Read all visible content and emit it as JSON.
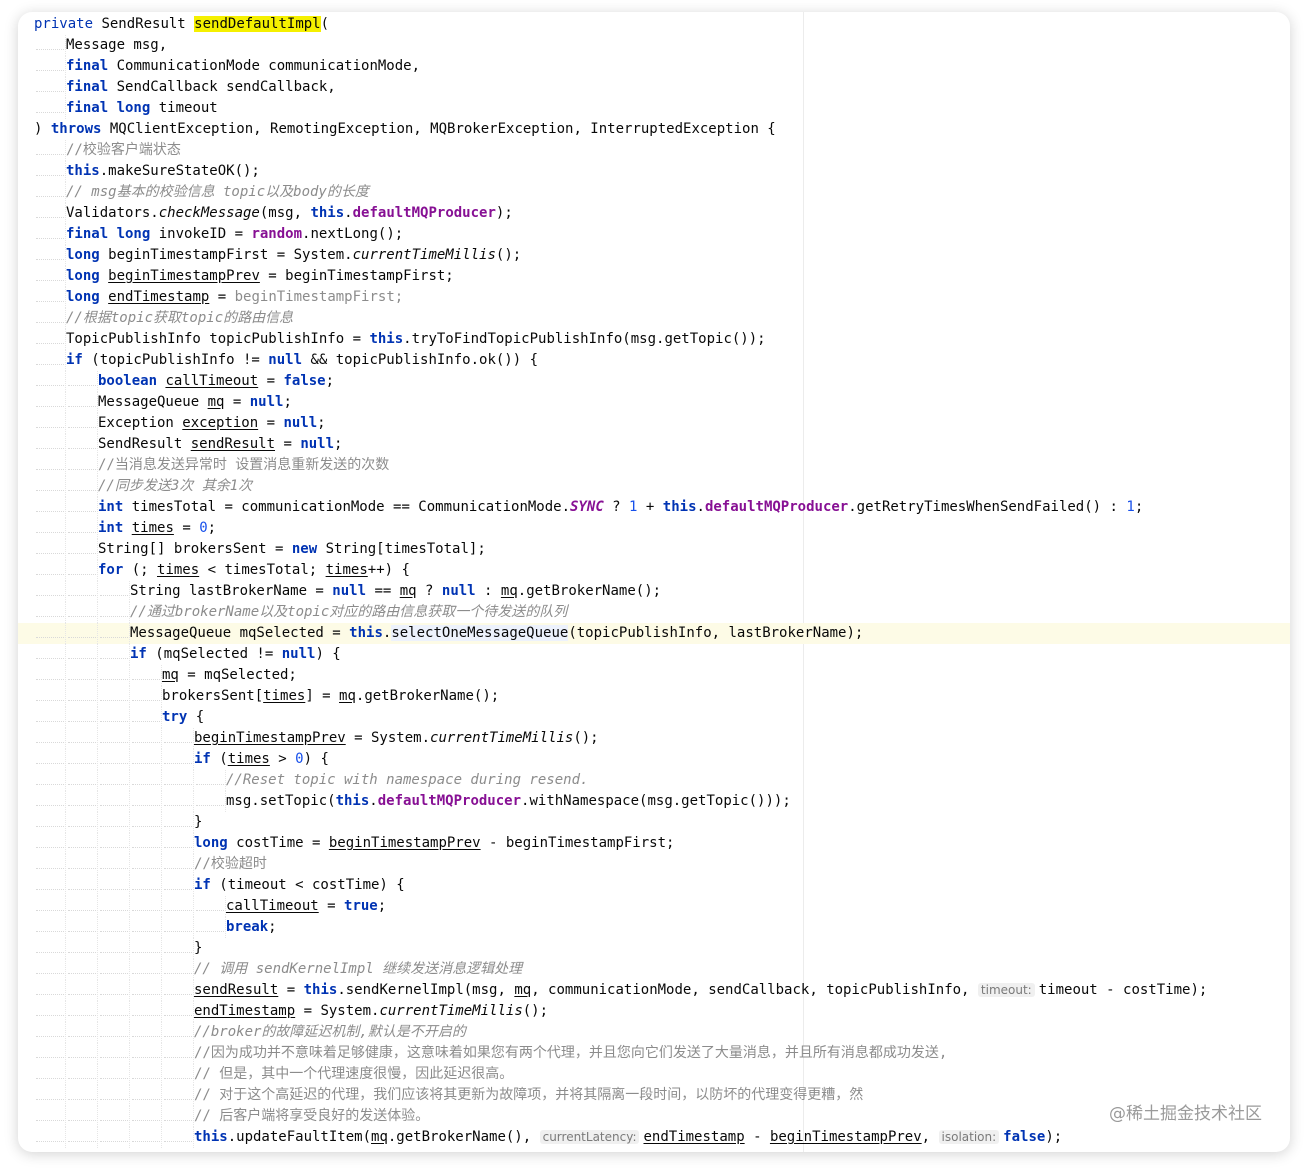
{
  "lines": [
    {
      "indent": 0,
      "hl": false,
      "tokens": [
        {
          "t": "private",
          "c": "kwn"
        },
        {
          "t": " SendResult "
        },
        {
          "t": "sendDefaultImpl",
          "c": "mhl"
        },
        {
          "t": "("
        }
      ]
    },
    {
      "indent": 1,
      "hl": false,
      "tokens": [
        {
          "t": "Message msg,"
        }
      ]
    },
    {
      "indent": 1,
      "hl": false,
      "tokens": [
        {
          "t": "final",
          "c": "kw"
        },
        {
          "t": " CommunicationMode communicationMode,"
        }
      ]
    },
    {
      "indent": 1,
      "hl": false,
      "tokens": [
        {
          "t": "final",
          "c": "kw"
        },
        {
          "t": " SendCallback sendCallback,"
        }
      ]
    },
    {
      "indent": 1,
      "hl": false,
      "tokens": [
        {
          "t": "final long",
          "c": "kw"
        },
        {
          "t": " timeout"
        }
      ]
    },
    {
      "indent": 0,
      "hl": false,
      "tokens": [
        {
          "t": ") "
        },
        {
          "t": "throws",
          "c": "kw"
        },
        {
          "t": " MQClientException, RemotingException, MQBrokerException, InterruptedException {"
        }
      ]
    },
    {
      "indent": 1,
      "hl": false,
      "tokens": [
        {
          "t": "//校验客户端状态",
          "c": "cm"
        }
      ]
    },
    {
      "indent": 1,
      "hl": false,
      "tokens": [
        {
          "t": "this",
          "c": "kw"
        },
        {
          "t": ".makeSureStateOK();"
        }
      ]
    },
    {
      "indent": 1,
      "hl": false,
      "tokens": [
        {
          "t": "// msg基本的校验信息 topic以及body的长度",
          "c": "cmi"
        }
      ]
    },
    {
      "indent": 1,
      "hl": false,
      "tokens": [
        {
          "t": "Validators."
        },
        {
          "t": "checkMessage",
          "c": "it"
        },
        {
          "t": "(msg, "
        },
        {
          "t": "this",
          "c": "kw"
        },
        {
          "t": "."
        },
        {
          "t": "defaultMQProducer",
          "c": "fld"
        },
        {
          "t": ");"
        }
      ]
    },
    {
      "indent": 1,
      "hl": false,
      "tokens": [
        {
          "t": "final long",
          "c": "kw"
        },
        {
          "t": " invokeID = "
        },
        {
          "t": "random",
          "c": "fld"
        },
        {
          "t": ".nextLong();"
        }
      ]
    },
    {
      "indent": 1,
      "hl": false,
      "tokens": [
        {
          "t": "long",
          "c": "kw"
        },
        {
          "t": " beginTimestampFirst = System."
        },
        {
          "t": "currentTimeMillis",
          "c": "it"
        },
        {
          "t": "();"
        }
      ]
    },
    {
      "indent": 1,
      "hl": false,
      "tokens": [
        {
          "t": "long",
          "c": "kw"
        },
        {
          "t": " "
        },
        {
          "t": "beginTimestampPrev",
          "c": "ul"
        },
        {
          "t": " = beginTimestampFirst;"
        }
      ]
    },
    {
      "indent": 1,
      "hl": false,
      "tokens": [
        {
          "t": "long",
          "c": "kw"
        },
        {
          "t": " "
        },
        {
          "t": "endTimestamp",
          "c": "ul"
        },
        {
          "t": " = "
        },
        {
          "t": "beginTimestampFirst;",
          "c": "cm"
        }
      ]
    },
    {
      "indent": 1,
      "hl": false,
      "tokens": [
        {
          "t": "//根据topic获取topic的路由信息",
          "c": "cmi"
        }
      ]
    },
    {
      "indent": 1,
      "hl": false,
      "tokens": [
        {
          "t": "TopicPublishInfo topicPublishInfo = "
        },
        {
          "t": "this",
          "c": "kw"
        },
        {
          "t": ".tryToFindTopicPublishInfo(msg.getTopic());"
        }
      ]
    },
    {
      "indent": 1,
      "hl": false,
      "tokens": [
        {
          "t": "if",
          "c": "kw"
        },
        {
          "t": " (topicPublishInfo != "
        },
        {
          "t": "null",
          "c": "kw"
        },
        {
          "t": " && topicPublishInfo.ok()) {"
        }
      ]
    },
    {
      "indent": 2,
      "hl": false,
      "tokens": [
        {
          "t": "boolean",
          "c": "kw"
        },
        {
          "t": " "
        },
        {
          "t": "callTimeout",
          "c": "ul"
        },
        {
          "t": " = "
        },
        {
          "t": "false",
          "c": "kw"
        },
        {
          "t": ";"
        }
      ]
    },
    {
      "indent": 2,
      "hl": false,
      "tokens": [
        {
          "t": "MessageQueue "
        },
        {
          "t": "mq",
          "c": "ul"
        },
        {
          "t": " = "
        },
        {
          "t": "null",
          "c": "kw"
        },
        {
          "t": ";"
        }
      ]
    },
    {
      "indent": 2,
      "hl": false,
      "tokens": [
        {
          "t": "Exception "
        },
        {
          "t": "exception",
          "c": "ul"
        },
        {
          "t": " = "
        },
        {
          "t": "null",
          "c": "kw"
        },
        {
          "t": ";"
        }
      ]
    },
    {
      "indent": 2,
      "hl": false,
      "tokens": [
        {
          "t": "SendResult "
        },
        {
          "t": "sendResult",
          "c": "ul"
        },
        {
          "t": " = "
        },
        {
          "t": "null",
          "c": "kw"
        },
        {
          "t": ";"
        }
      ]
    },
    {
      "indent": 2,
      "hl": false,
      "tokens": [
        {
          "t": "//当消息发送异常时 设置消息重新发送的次数",
          "c": "cm"
        }
      ]
    },
    {
      "indent": 2,
      "hl": false,
      "tokens": [
        {
          "t": "//同步发送3次 其余1次",
          "c": "cmi"
        }
      ]
    },
    {
      "indent": 2,
      "hl": false,
      "tokens": [
        {
          "t": "int",
          "c": "kw"
        },
        {
          "t": " timesTotal = communicationMode == CommunicationMode."
        },
        {
          "t": "SYNC",
          "c": "fld it"
        },
        {
          "t": " ? "
        },
        {
          "t": "1",
          "c": "num"
        },
        {
          "t": " + "
        },
        {
          "t": "this",
          "c": "kw"
        },
        {
          "t": "."
        },
        {
          "t": "defaultMQProducer",
          "c": "fld"
        },
        {
          "t": ".getRetryTimesWhenSendFailed() : "
        },
        {
          "t": "1",
          "c": "num"
        },
        {
          "t": ";"
        }
      ]
    },
    {
      "indent": 2,
      "hl": false,
      "tokens": [
        {
          "t": "int",
          "c": "kw"
        },
        {
          "t": " "
        },
        {
          "t": "times",
          "c": "ul"
        },
        {
          "t": " = "
        },
        {
          "t": "0",
          "c": "num"
        },
        {
          "t": ";"
        }
      ]
    },
    {
      "indent": 2,
      "hl": false,
      "tokens": [
        {
          "t": "String[] brokersSent = "
        },
        {
          "t": "new",
          "c": "kw"
        },
        {
          "t": " String[timesTotal];"
        }
      ]
    },
    {
      "indent": 2,
      "hl": false,
      "tokens": [
        {
          "t": "for",
          "c": "kw"
        },
        {
          "t": " (; "
        },
        {
          "t": "times",
          "c": "ul"
        },
        {
          "t": " < timesTotal; "
        },
        {
          "t": "times",
          "c": "ul"
        },
        {
          "t": "++) {"
        }
      ]
    },
    {
      "indent": 3,
      "hl": false,
      "tokens": [
        {
          "t": "String lastBrokerName = "
        },
        {
          "t": "null",
          "c": "kw"
        },
        {
          "t": " == "
        },
        {
          "t": "mq",
          "c": "ul"
        },
        {
          "t": " ? "
        },
        {
          "t": "null",
          "c": "kw"
        },
        {
          "t": " : "
        },
        {
          "t": "mq",
          "c": "ul"
        },
        {
          "t": ".getBrokerName();"
        }
      ]
    },
    {
      "indent": 3,
      "hl": false,
      "tokens": [
        {
          "t": "//通过brokerName以及topic对应的路由信息获取一个待发送的队列",
          "c": "cmi"
        }
      ]
    },
    {
      "indent": 3,
      "hl": true,
      "tokens": [
        {
          "t": "MessageQueue mqSelected = "
        },
        {
          "t": "this",
          "c": "kw"
        },
        {
          "t": "."
        },
        {
          "t": "selectOneMessageQueue",
          "c": "sel"
        },
        {
          "t": "(topicPublishInfo, lastBrokerName);"
        }
      ]
    },
    {
      "indent": 3,
      "hl": false,
      "tokens": [
        {
          "t": "if",
          "c": "kw"
        },
        {
          "t": " (mqSelected != "
        },
        {
          "t": "null",
          "c": "kw"
        },
        {
          "t": ") {"
        }
      ]
    },
    {
      "indent": 4,
      "hl": false,
      "tokens": [
        {
          "t": "mq",
          "c": "ul"
        },
        {
          "t": " = mqSelected;"
        }
      ]
    },
    {
      "indent": 4,
      "hl": false,
      "tokens": [
        {
          "t": "brokersSent["
        },
        {
          "t": "times",
          "c": "ul"
        },
        {
          "t": "] = "
        },
        {
          "t": "mq",
          "c": "ul"
        },
        {
          "t": ".getBrokerName();"
        }
      ]
    },
    {
      "indent": 4,
      "hl": false,
      "tokens": [
        {
          "t": "try",
          "c": "kw"
        },
        {
          "t": " {"
        }
      ]
    },
    {
      "indent": 5,
      "hl": false,
      "tokens": [
        {
          "t": "beginTimestampPrev",
          "c": "ul"
        },
        {
          "t": " = System."
        },
        {
          "t": "currentTimeMillis",
          "c": "it"
        },
        {
          "t": "();"
        }
      ]
    },
    {
      "indent": 5,
      "hl": false,
      "tokens": [
        {
          "t": "if",
          "c": "kw"
        },
        {
          "t": " ("
        },
        {
          "t": "times",
          "c": "ul"
        },
        {
          "t": " > "
        },
        {
          "t": "0",
          "c": "num"
        },
        {
          "t": ") {"
        }
      ]
    },
    {
      "indent": 6,
      "hl": false,
      "tokens": [
        {
          "t": "//Reset topic with namespace during resend.",
          "c": "cmi"
        }
      ]
    },
    {
      "indent": 6,
      "hl": false,
      "tokens": [
        {
          "t": "msg.setTopic("
        },
        {
          "t": "this",
          "c": "kw"
        },
        {
          "t": "."
        },
        {
          "t": "defaultMQProducer",
          "c": "fld"
        },
        {
          "t": ".withNamespace(msg.getTopic()));"
        }
      ]
    },
    {
      "indent": 5,
      "hl": false,
      "tokens": [
        {
          "t": "}"
        }
      ]
    },
    {
      "indent": 5,
      "hl": false,
      "tokens": [
        {
          "t": "long",
          "c": "kw"
        },
        {
          "t": " costTime = "
        },
        {
          "t": "beginTimestampPrev",
          "c": "ul"
        },
        {
          "t": " - beginTimestampFirst;"
        }
      ]
    },
    {
      "indent": 5,
      "hl": false,
      "tokens": [
        {
          "t": "//校验超时",
          "c": "cm"
        }
      ]
    },
    {
      "indent": 5,
      "hl": false,
      "tokens": [
        {
          "t": "if",
          "c": "kw"
        },
        {
          "t": " (timeout < costTime) {"
        }
      ]
    },
    {
      "indent": 6,
      "hl": false,
      "tokens": [
        {
          "t": "callTimeout",
          "c": "ul"
        },
        {
          "t": " = "
        },
        {
          "t": "true",
          "c": "kw"
        },
        {
          "t": ";"
        }
      ]
    },
    {
      "indent": 6,
      "hl": false,
      "tokens": [
        {
          "t": "break",
          "c": "kw"
        },
        {
          "t": ";"
        }
      ]
    },
    {
      "indent": 5,
      "hl": false,
      "tokens": [
        {
          "t": "}"
        }
      ]
    },
    {
      "indent": 5,
      "hl": false,
      "tokens": [
        {
          "t": "// 调用 sendKernelImpl 继续发送消息逻辑处理",
          "c": "cmi"
        }
      ]
    },
    {
      "indent": 5,
      "hl": false,
      "tokens": [
        {
          "t": "sendResult",
          "c": "ul"
        },
        {
          "t": " = "
        },
        {
          "t": "this",
          "c": "kw"
        },
        {
          "t": ".sendKernelImpl(msg, "
        },
        {
          "t": "mq",
          "c": "ul"
        },
        {
          "t": ", communicationMode, sendCallback, topicPublishInfo, "
        },
        {
          "t": "timeout:",
          "c": "hint"
        },
        {
          "t": "timeout - costTime);"
        }
      ]
    },
    {
      "indent": 5,
      "hl": false,
      "tokens": [
        {
          "t": "endTimestamp",
          "c": "ul"
        },
        {
          "t": " = System."
        },
        {
          "t": "currentTimeMillis",
          "c": "it"
        },
        {
          "t": "();"
        }
      ]
    },
    {
      "indent": 5,
      "hl": false,
      "tokens": [
        {
          "t": "//broker的故障延迟机制,默认是不开启的",
          "c": "cmi"
        }
      ]
    },
    {
      "indent": 5,
      "hl": false,
      "tokens": [
        {
          "t": "//因为成功并不意味着足够健康，这意味着如果您有两个代理，并且您向它们发送了大量消息，并且所有消息都成功发送,",
          "c": "cm"
        }
      ]
    },
    {
      "indent": 5,
      "hl": false,
      "tokens": [
        {
          "t": "// 但是，其中一个代理速度很慢，因此延迟很高。",
          "c": "cm"
        }
      ]
    },
    {
      "indent": 5,
      "hl": false,
      "tokens": [
        {
          "t": "// 对于这个高延迟的代理，我们应该将其更新为故障项，并将其隔离一段时间，以防坏的代理变得更糟，然",
          "c": "cm"
        }
      ]
    },
    {
      "indent": 5,
      "hl": false,
      "tokens": [
        {
          "t": "// 后客户端将享受良好的发送体验。",
          "c": "cm"
        }
      ]
    },
    {
      "indent": 5,
      "hl": false,
      "tokens": [
        {
          "t": "this",
          "c": "kw"
        },
        {
          "t": ".updateFaultItem("
        },
        {
          "t": "mq",
          "c": "ul"
        },
        {
          "t": ".getBrokerName(), "
        },
        {
          "t": "currentLatency:",
          "c": "hint"
        },
        {
          "t": "endTimestamp",
          "c": "ul"
        },
        {
          "t": " - "
        },
        {
          "t": "beginTimestampPrev",
          "c": "ul"
        },
        {
          "t": ", "
        },
        {
          "t": "isolation:",
          "c": "hint"
        },
        {
          "t": "false",
          "c": "kw"
        },
        {
          "t": ");"
        }
      ]
    }
  ],
  "watermark": "@稀土掘金技术社区"
}
